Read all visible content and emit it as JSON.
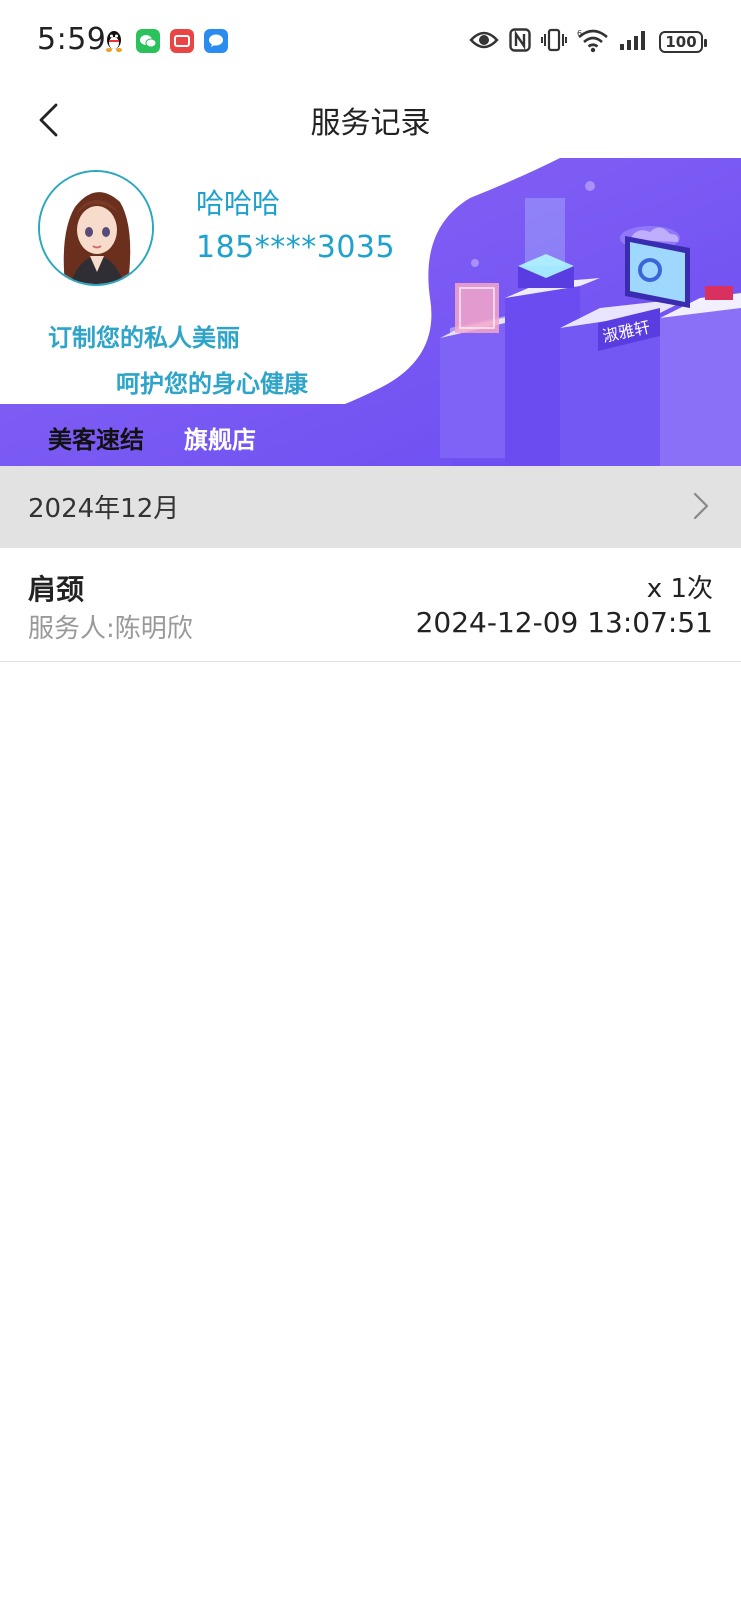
{
  "status_bar": {
    "time": "5:59",
    "notification_icons": [
      "qq-icon",
      "wechat-icon",
      "mail-icon",
      "message-icon"
    ],
    "system_icons": [
      "eye-icon",
      "nfc-icon",
      "vibrate-icon",
      "wifi-icon",
      "signal-icon"
    ],
    "battery": "100"
  },
  "header": {
    "title": "服务记录",
    "back_icon": "chevron-left-icon"
  },
  "banner": {
    "user_name": "哈哈哈",
    "phone": "185****3035",
    "slogan_line1": "订制您的私人美丽",
    "slogan_line2": "呵护您的身心健康",
    "store_brand": "美客速结",
    "store_type": "旗舰店",
    "sign_text": "淑雅轩",
    "colors": {
      "purple": "#7b5cf5",
      "deep_purple": "#5d3fe0",
      "cyan_text": "#1da1cf"
    }
  },
  "records": {
    "month": "2024年12月",
    "items": [
      {
        "service": "肩颈",
        "staff": "服务人:陈明欣",
        "count": "x 1次",
        "time": "2024-12-09 13:07:51"
      }
    ]
  }
}
